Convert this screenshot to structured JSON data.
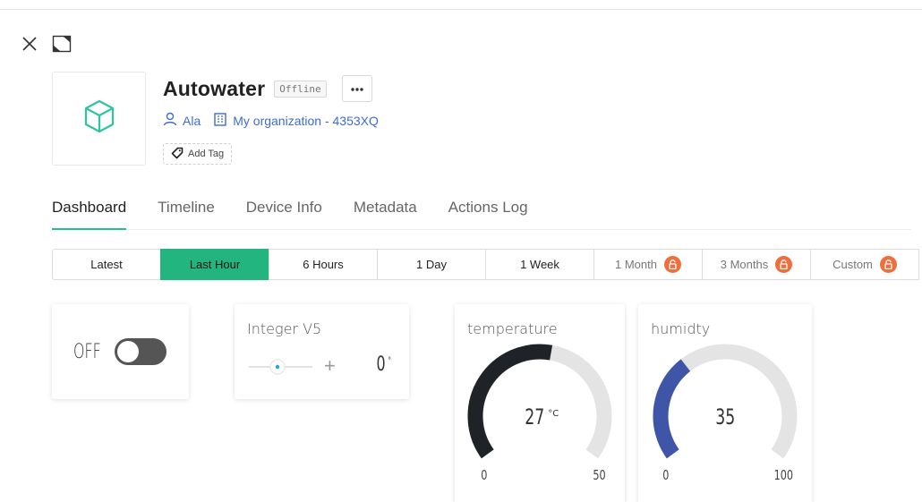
{
  "device": {
    "name": "Autowater",
    "status": "Offline",
    "owner": "Ala",
    "organization": "My organization - 4353XQ",
    "add_tag_label": "Add Tag"
  },
  "tabs": [
    {
      "label": "Dashboard",
      "active": true
    },
    {
      "label": "Timeline"
    },
    {
      "label": "Device Info"
    },
    {
      "label": "Metadata"
    },
    {
      "label": "Actions Log"
    }
  ],
  "time_ranges": [
    {
      "label": "Latest"
    },
    {
      "label": "Last Hour",
      "active": true
    },
    {
      "label": "6 Hours"
    },
    {
      "label": "1 Day"
    },
    {
      "label": "1 Week"
    },
    {
      "label": "1 Month",
      "locked": true
    },
    {
      "label": "3 Months",
      "locked": true
    },
    {
      "label": "Custom",
      "locked": true
    }
  ],
  "widgets": {
    "switch": {
      "state_label": "OFF"
    },
    "slider": {
      "title": "Integer V5",
      "value": "0",
      "unit": "°",
      "minus": "—",
      "plus": "+"
    },
    "temperature": {
      "title": "temperature",
      "value": "27",
      "unit": "°C",
      "min": "0",
      "max": "50",
      "num_value": 27,
      "num_min": 0,
      "num_max": 50,
      "color": "#1f2328"
    },
    "humidity": {
      "title": "humidty",
      "value": "35",
      "unit": "",
      "min": "0",
      "max": "100",
      "num_value": 35,
      "num_min": 0,
      "num_max": 100,
      "color": "#3f55a8"
    }
  },
  "colors": {
    "accent": "#22b57f",
    "link": "#3f6cd1",
    "lock": "#ef6f3c",
    "device_icon": "#2ec4a0"
  },
  "icons": {
    "close": "close-icon",
    "expand": "expand-icon",
    "device": "cube-icon",
    "user": "user-icon",
    "org": "building-icon",
    "tag": "tag-icon",
    "more": "more-icon",
    "lock": "lock-icon"
  }
}
